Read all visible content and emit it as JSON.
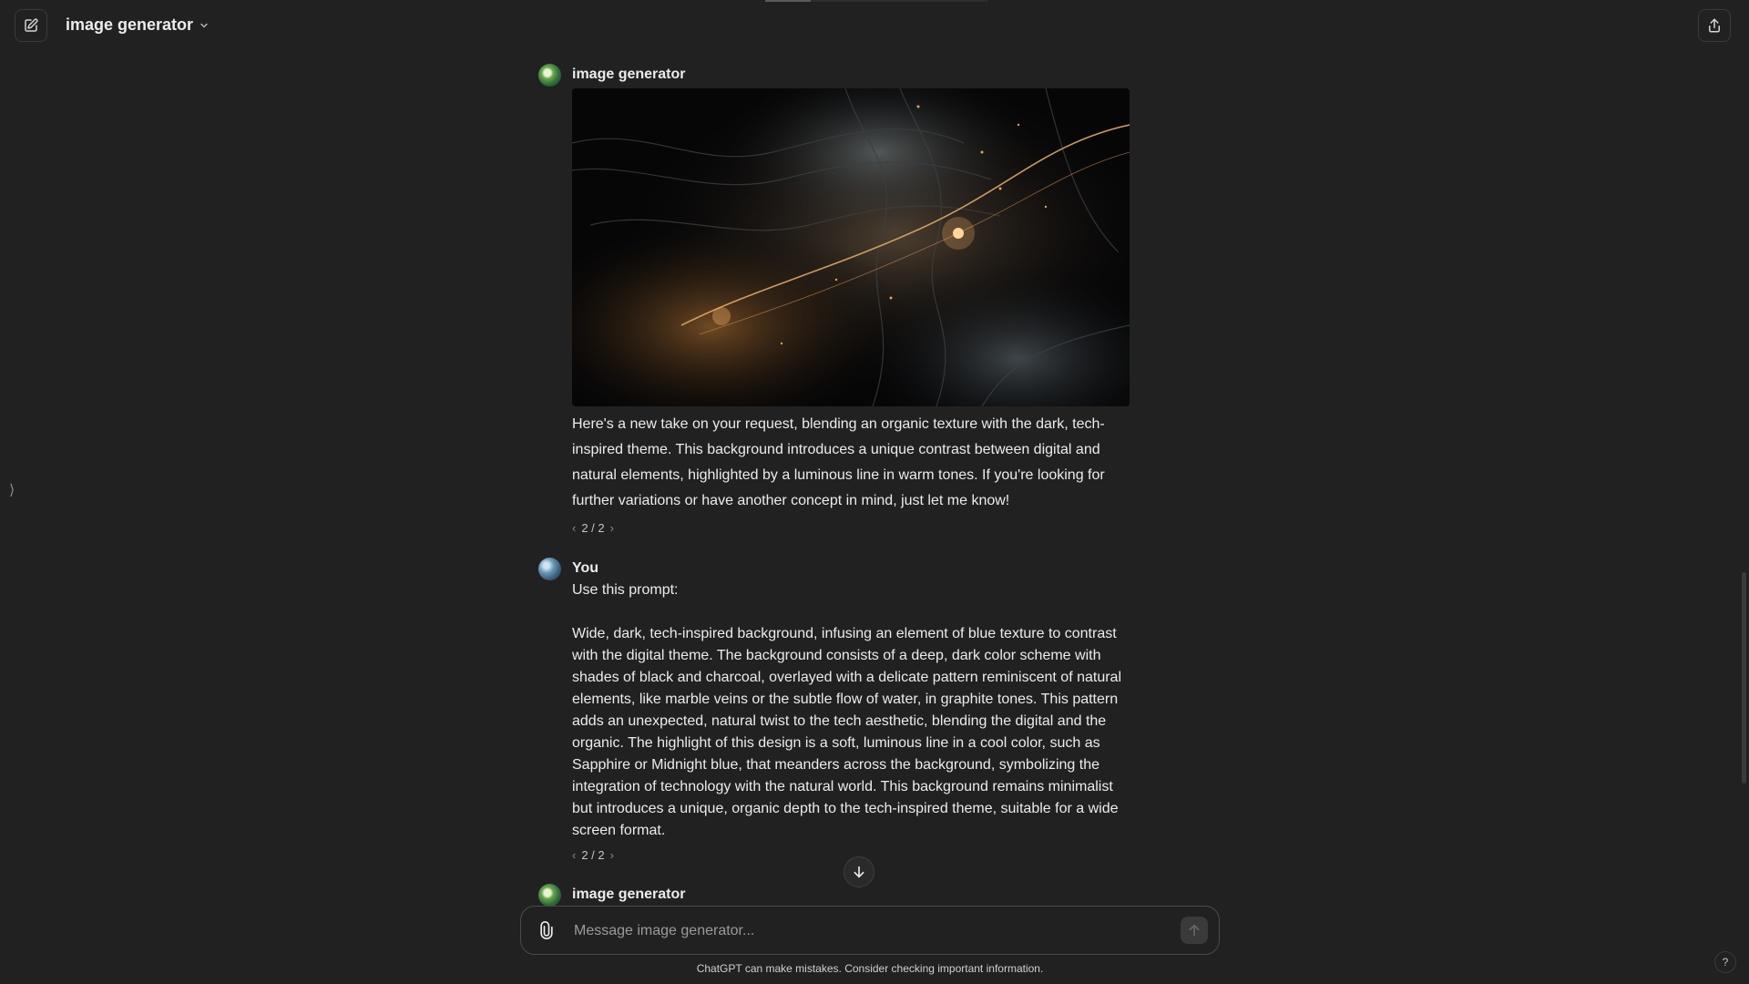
{
  "header": {
    "title": "image generator",
    "new_chat_icon": "edit-icon",
    "share_icon": "share-icon"
  },
  "messages": [
    {
      "author": "image generator",
      "role": "assistant",
      "image_alt_icon": "generated-image",
      "text": "Here's a new take on your request, blending an organic texture with the dark, tech-inspired theme. This background introduces a unique contrast between digital and natural elements, highlighted by a luminous line in warm tones. If you're looking for further variations or have another concept in mind, just let me know!",
      "pager": "2 / 2"
    },
    {
      "author": "You",
      "role": "user",
      "intro": "Use this prompt:",
      "text": "Wide, dark, tech-inspired background, infusing an element of blue texture to contrast with the digital theme. The background consists of a deep, dark color scheme with shades of black and charcoal, overlayed with a delicate pattern reminiscent of natural elements, like marble veins or the subtle flow of water, in graphite tones. This pattern adds an unexpected, natural twist to the tech aesthetic, blending the digital and the organic. The highlight of this design is a soft, luminous line in a  cool color, such as Sapphire or Midnight blue, that meanders across the background, symbolizing the integration of technology with the natural world. This background remains minimalist but introduces a unique, organic depth to the tech-inspired theme, suitable for a wide screen format.",
      "pager": "2 / 2"
    },
    {
      "author": "image generator",
      "role": "assistant"
    }
  ],
  "composer": {
    "placeholder": "Message image generator...",
    "attach_icon": "paperclip-icon",
    "send_icon": "arrow-up-icon"
  },
  "footer": {
    "disclaimer": "ChatGPT can make mistakes. Consider checking important information.",
    "help_label": "?"
  },
  "colors": {
    "background": "#212121",
    "text": "#ececec",
    "muted": "#9b9b9b",
    "border": "#4a4a4a"
  }
}
